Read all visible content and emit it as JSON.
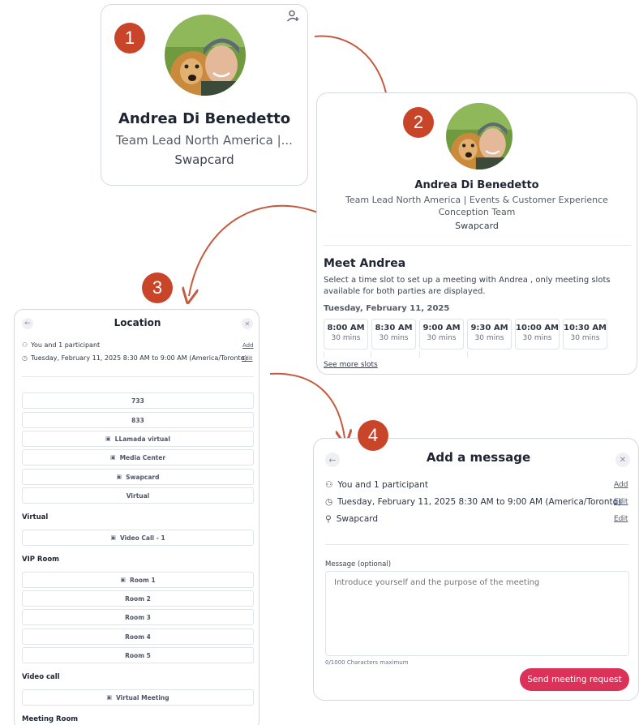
{
  "colors": {
    "badge": "#c9452a",
    "arrow": "#c65a3e",
    "primary_button": "#dc3158",
    "border": "#d4d8e0"
  },
  "steps": [
    "1",
    "2",
    "3",
    "4"
  ],
  "profile_card": {
    "name": "Andrea Di Benedetto",
    "title_truncated": "Team Lead North America |...",
    "company": "Swapcard",
    "icon": "add-contact-icon"
  },
  "profile_detail": {
    "name": "Andrea Di Benedetto",
    "title": "Team Lead North America | Events & Customer Experience Conception Team",
    "company": "Swapcard",
    "meet_heading": "Meet Andrea",
    "description": "Select a time slot to set up a meeting with Andrea , only meeting slots available for both parties are displayed.",
    "date": "Tuesday, February 11, 2025",
    "slots": [
      {
        "time": "8:00 AM",
        "duration": "30 mins"
      },
      {
        "time": "8:30 AM",
        "duration": "30 mins"
      },
      {
        "time": "9:00 AM",
        "duration": "30 mins"
      },
      {
        "time": "9:30 AM",
        "duration": "30 mins"
      },
      {
        "time": "10:00 AM",
        "duration": "30 mins"
      },
      {
        "time": "10:30 AM",
        "duration": "30 mins"
      }
    ],
    "see_more": "See more slots"
  },
  "location_dialog": {
    "title": "Location",
    "participants": "You and 1 participant",
    "participants_action": "Add",
    "datetime": "Tuesday, February 11, 2025 8:30 AM to 9:00 AM (America/Toronto)",
    "datetime_action": "Edit",
    "options_top": [
      {
        "label": "733",
        "icon": ""
      },
      {
        "label": "833",
        "icon": ""
      },
      {
        "label": "LLamada virtual",
        "icon": "video-icon"
      },
      {
        "label": "Media Center",
        "icon": "video-icon"
      },
      {
        "label": "Swapcard",
        "icon": "video-icon"
      },
      {
        "label": "Virtual",
        "icon": ""
      }
    ],
    "sections": [
      {
        "heading": "Virtual",
        "options": [
          {
            "label": "Video Call - 1",
            "icon": "video-icon"
          }
        ]
      },
      {
        "heading": "VIP Room",
        "options": [
          {
            "label": "Room 1",
            "icon": "video-icon"
          },
          {
            "label": "Room 2",
            "icon": ""
          },
          {
            "label": "Room 3",
            "icon": ""
          },
          {
            "label": "Room 4",
            "icon": ""
          },
          {
            "label": "Room 5",
            "icon": ""
          }
        ]
      },
      {
        "heading": "Video call",
        "options": [
          {
            "label": "Virtual Meeting",
            "icon": "video-icon"
          }
        ]
      },
      {
        "heading": "Meeting Room",
        "options": []
      }
    ]
  },
  "message_dialog": {
    "title": "Add a message",
    "participants": "You and 1 participant",
    "participants_action": "Add",
    "datetime": "Tuesday, February 11, 2025 8:30 AM to 9:00 AM (America/Toronto)",
    "datetime_action": "Edit",
    "location": "Swapcard",
    "location_action": "Edit",
    "message_label": "Message (optional)",
    "message_placeholder": "Introduce yourself and the purpose of the meeting",
    "counter": "0/1000 Characters maximum",
    "send_label": "Send meeting request"
  }
}
